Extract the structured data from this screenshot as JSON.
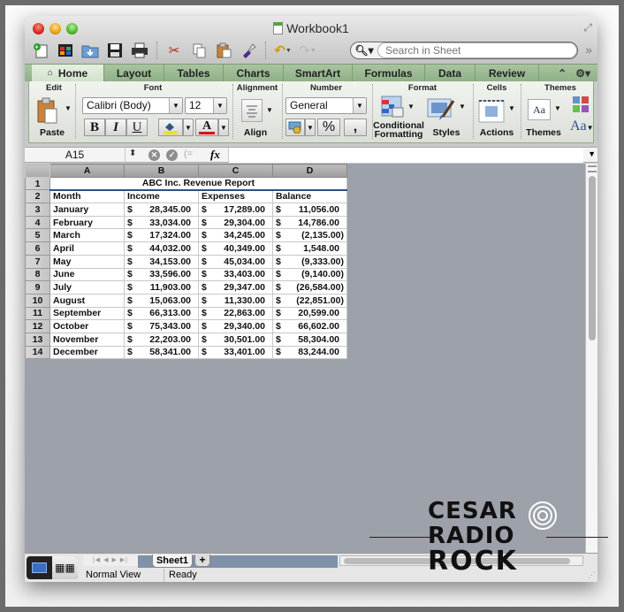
{
  "window": {
    "title": "Workbook1"
  },
  "toolbar": {
    "buttons": [
      "new-workbook",
      "template-gallery",
      "open",
      "save",
      "print",
      "cut",
      "copy",
      "paste",
      "format-painter",
      "undo",
      "redo"
    ],
    "search_placeholder": "Search in Sheet"
  },
  "tabs": [
    {
      "label": "Home",
      "active": true
    },
    {
      "label": "Layout"
    },
    {
      "label": "Tables"
    },
    {
      "label": "Charts"
    },
    {
      "label": "SmartArt"
    },
    {
      "label": "Formulas"
    },
    {
      "label": "Data"
    },
    {
      "label": "Review"
    }
  ],
  "ribbon": {
    "groups": {
      "edit": "Edit",
      "font": "Font",
      "alignment": "Alignment",
      "number": "Number",
      "format": "Format",
      "cells": "Cells",
      "themes": "Themes"
    },
    "paste_label": "Paste",
    "font_name": "Calibri (Body)",
    "font_size": "12",
    "bold": "B",
    "italic": "I",
    "underline": "U",
    "font_color_glyph": "A",
    "highlight_color": "#f0e21a",
    "font_color": "#d2141a",
    "align_label": "Align",
    "number_format": "General",
    "percent": "%",
    "comma": ",",
    "conditional_formatting_line1": "Conditional",
    "conditional_formatting_line2": "Formatting",
    "styles_label": "Styles",
    "actions_label": "Actions",
    "themes_label": "Themes",
    "theme_fonts_glyph": "Aa"
  },
  "formula_bar": {
    "name_box": "A15",
    "fx": "fx",
    "value": ""
  },
  "sheet": {
    "columns": [
      "A",
      "B",
      "C",
      "D"
    ],
    "title": "ABC Inc. Revenue Report",
    "headers": [
      "Month",
      "Income",
      "Expenses",
      "Balance"
    ],
    "currency_symbol": "$",
    "rows": [
      {
        "row": "3",
        "month": "January",
        "income": "28,345.00",
        "expenses": "17,289.00",
        "balance": "11,056.00"
      },
      {
        "row": "4",
        "month": "February",
        "income": "33,034.00",
        "expenses": "29,304.00",
        "balance": "14,786.00"
      },
      {
        "row": "5",
        "month": "March",
        "income": "17,324.00",
        "expenses": "34,245.00",
        "balance": "(2,135.00)"
      },
      {
        "row": "6",
        "month": "April",
        "income": "44,032.00",
        "expenses": "40,349.00",
        "balance": "1,548.00"
      },
      {
        "row": "7",
        "month": "May",
        "income": "34,153.00",
        "expenses": "45,034.00",
        "balance": "(9,333.00)"
      },
      {
        "row": "8",
        "month": "June",
        "income": "33,596.00",
        "expenses": "33,403.00",
        "balance": "(9,140.00)"
      },
      {
        "row": "9",
        "month": "July",
        "income": "11,903.00",
        "expenses": "29,347.00",
        "balance": "(26,584.00)"
      },
      {
        "row": "10",
        "month": "August",
        "income": "15,063.00",
        "expenses": "11,330.00",
        "balance": "(22,851.00)"
      },
      {
        "row": "11",
        "month": "September",
        "income": "66,313.00",
        "expenses": "22,863.00",
        "balance": "20,599.00"
      },
      {
        "row": "12",
        "month": "October",
        "income": "75,343.00",
        "expenses": "29,340.00",
        "balance": "66,602.00"
      },
      {
        "row": "13",
        "month": "November",
        "income": "22,203.00",
        "expenses": "30,501.00",
        "balance": "58,304.00"
      },
      {
        "row": "14",
        "month": "December",
        "income": "58,341.00",
        "expenses": "33,401.00",
        "balance": "83,244.00"
      }
    ]
  },
  "bottom": {
    "sheet_tab": "Sheet1",
    "add_sheet": "+",
    "view_label": "Normal View",
    "status": "Ready"
  },
  "watermark": {
    "line1": "CESAR",
    "line2": "RADIO",
    "line3": "ROCK"
  }
}
